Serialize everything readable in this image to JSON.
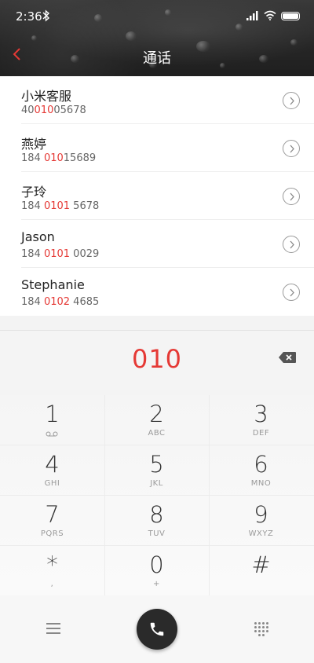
{
  "status_bar": {
    "time": "2:36"
  },
  "header": {
    "title": "通话"
  },
  "contacts": [
    {
      "name": "小米客服",
      "number_pre": "40",
      "number_match": "010",
      "number_post": "05678"
    },
    {
      "name": "燕婷",
      "number_pre": "184 ",
      "number_match": "010",
      "number_post": "15689"
    },
    {
      "name": "子玲",
      "number_pre": "184 ",
      "number_match": "0101",
      "number_post": " 5678"
    },
    {
      "name": "Jason",
      "number_pre": "184 ",
      "number_match": "0101",
      "number_post": " 0029"
    },
    {
      "name": "Stephanie",
      "number_pre": "184 ",
      "number_match": "0102",
      "number_post": " 4685"
    }
  ],
  "dialer": {
    "entered_number": "010"
  },
  "keypad": [
    {
      "digit": "1",
      "letters": ""
    },
    {
      "digit": "2",
      "letters": "ABC"
    },
    {
      "digit": "3",
      "letters": "DEF"
    },
    {
      "digit": "4",
      "letters": "GHI"
    },
    {
      "digit": "5",
      "letters": "JKL"
    },
    {
      "digit": "6",
      "letters": "MNO"
    },
    {
      "digit": "7",
      "letters": "PQRS"
    },
    {
      "digit": "8",
      "letters": "TUV"
    },
    {
      "digit": "9",
      "letters": "WXYZ"
    },
    {
      "digit": "*",
      "letters": ","
    },
    {
      "digit": "0",
      "letters": "+"
    },
    {
      "digit": "#",
      "letters": ""
    }
  ],
  "icons": {
    "back": "chevron-left-icon",
    "backspace": "backspace-icon",
    "voicemail": "voicemail-icon",
    "menu": "menu-icon",
    "call": "phone-icon",
    "dialpad": "dialpad-icon",
    "info": "chevron-right-icon"
  },
  "colors": {
    "accent": "#e53935",
    "header_bg": "#262626",
    "call_button": "#2a2a2a"
  }
}
